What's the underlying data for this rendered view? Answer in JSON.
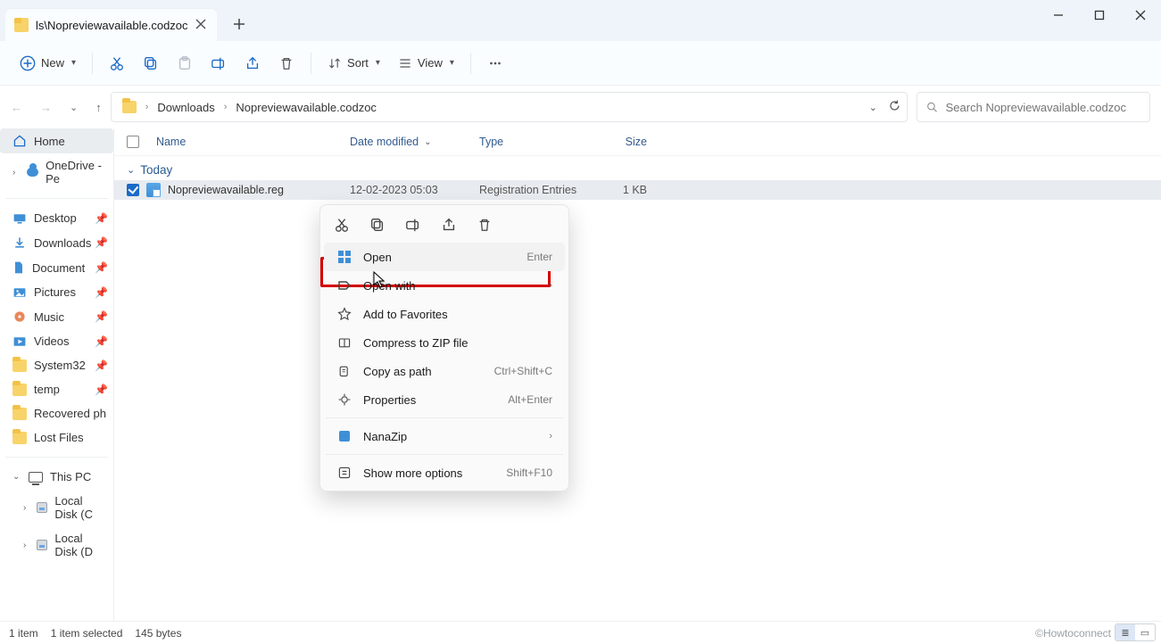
{
  "tab": {
    "title": "ls\\Nopreviewavailable.codzoc"
  },
  "toolbar": {
    "new": "New",
    "sort": "Sort",
    "view": "View"
  },
  "breadcrumb": {
    "items": [
      "Downloads",
      "Nopreviewavailable.codzoc"
    ]
  },
  "search": {
    "placeholder": "Search Nopreviewavailable.codzoc"
  },
  "columns": {
    "name": "Name",
    "date": "Date modified",
    "type": "Type",
    "size": "Size"
  },
  "group": {
    "label": "Today"
  },
  "rows": [
    {
      "name": "Nopreviewavailable.reg",
      "date": "12-02-2023 05:03",
      "type": "Registration Entries",
      "size": "1 KB"
    }
  ],
  "sidebar": {
    "home": "Home",
    "onedrive": "OneDrive - Pe",
    "quick": [
      "Desktop",
      "Downloads",
      "Document",
      "Pictures",
      "Music",
      "Videos",
      "System32",
      "temp",
      "Recovered ph",
      "Lost Files"
    ],
    "thispc": "This PC",
    "disks": [
      "Local Disk (C",
      "Local Disk (D"
    ]
  },
  "context": {
    "open": "Open",
    "open_sc": "Enter",
    "openwith": "Open with",
    "fav": "Add to Favorites",
    "zip": "Compress to ZIP file",
    "copypath": "Copy as path",
    "copypath_sc": "Ctrl+Shift+C",
    "properties": "Properties",
    "properties_sc": "Alt+Enter",
    "nanazip": "NanaZip",
    "showmore": "Show more options",
    "showmore_sc": "Shift+F10"
  },
  "status": {
    "items": "1 item",
    "selected": "1 item selected",
    "bytes": "145 bytes",
    "watermark": "©Howtoconnect"
  }
}
